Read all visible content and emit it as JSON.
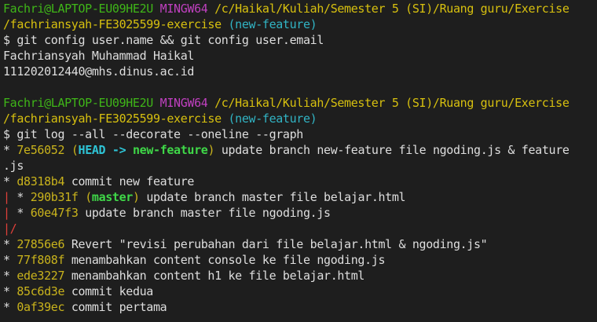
{
  "prompt": {
    "user": "Fachri@LAPTOP-EU09HE2U",
    "env": "MINGW64",
    "path_line1": "/c/Haikal/Kuliah/Semester 5 (SI)/Ruang guru/Exercise",
    "path_line2": "/fachriansyah-FE3025599-exercise",
    "branch": "(new-feature)",
    "symbol": "$"
  },
  "commands": [
    "git config user.name && git config user.email",
    "git log --all --decorate --oneline --graph"
  ],
  "config_output": [
    "Fachriansyah Muhammad Haikal",
    "111202012440@mhs.dinus.ac.id"
  ],
  "log": {
    "c1": {
      "graph": "* ",
      "hash": "7e56052",
      "head": "HEAD -> ",
      "ref": "new-feature",
      "msg": " update branch new-feature file ngoding.js & feature",
      "wrap": ".js"
    },
    "c2": {
      "graph": "* ",
      "hash": "d8318b4",
      "msg": " commit new feature"
    },
    "c3": {
      "rail": "| ",
      "graph": "* ",
      "hash": "290b31f",
      "ref": "master",
      "msg": " update branch master file belajar.html"
    },
    "c4": {
      "rail": "| ",
      "graph": "* ",
      "hash": "60e47f3",
      "msg": " update branch master file ngoding.js"
    },
    "merge": "|/",
    "c5": {
      "graph": "* ",
      "hash": "27856e6",
      "msg": " Revert \"revisi perubahan dari file belajar.html & ngoding.js\""
    },
    "c6": {
      "graph": "* ",
      "hash": "77f808f",
      "msg": " menambahkan content console ke file ngoding.js"
    },
    "c7": {
      "graph": "* ",
      "hash": "ede3227",
      "msg": " menambahkan content h1 ke file belajar.html"
    },
    "c8": {
      "graph": "* ",
      "hash": "85c6d3e",
      "msg": " commit kedua"
    },
    "c9": {
      "graph": "* ",
      "hash": "0af39ec",
      "msg": " commit pertama"
    }
  },
  "colors": {
    "background": "#1e1e1e",
    "user": "#3fb618",
    "env": "#bf40bf",
    "path": "#d7c00f",
    "branch": "#31b4c4",
    "hash": "#c9b31c",
    "head": "#2ec4d6",
    "ref": "#3fd848",
    "rail": "#e0403a"
  }
}
